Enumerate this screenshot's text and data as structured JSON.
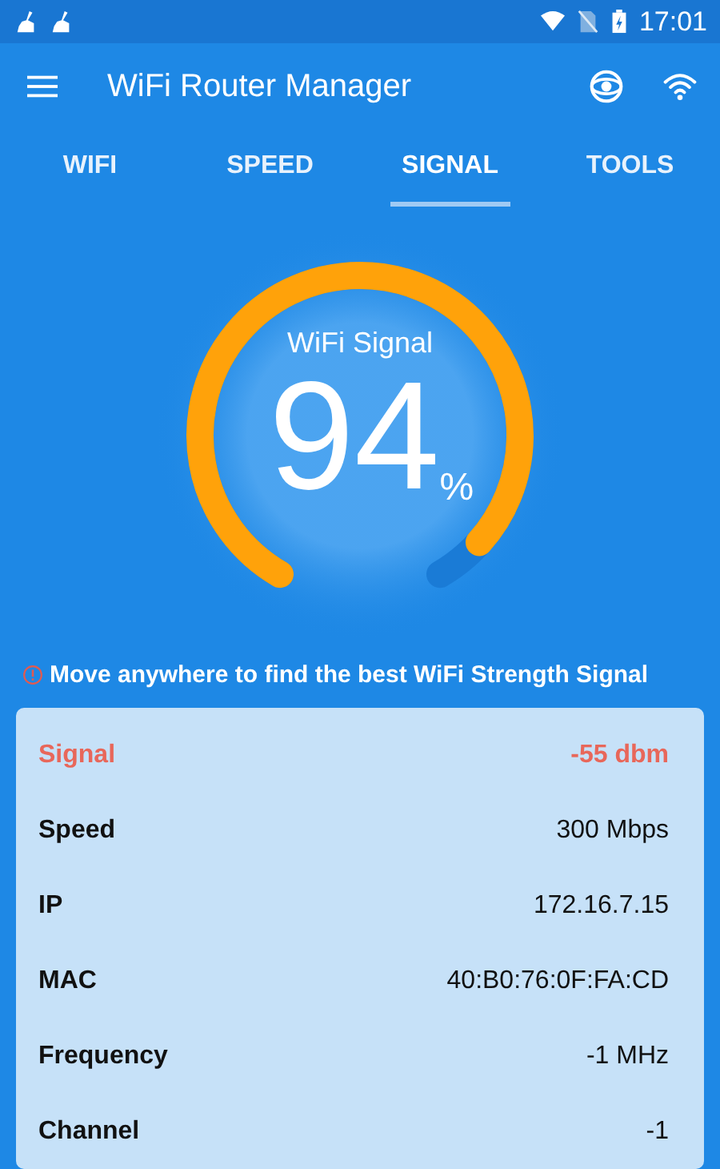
{
  "status_bar": {
    "time": "17:01"
  },
  "app_bar": {
    "title": "WiFi Router Manager"
  },
  "tabs": [
    {
      "label": "WIFI",
      "selected": false
    },
    {
      "label": "SPEED",
      "selected": false
    },
    {
      "label": "SIGNAL",
      "selected": true
    },
    {
      "label": "TOOLS",
      "selected": false
    }
  ],
  "gauge": {
    "title": "WiFi Signal",
    "value": "94",
    "unit": "%"
  },
  "hint": "Move anywhere to find the best WiFi Strength Signal",
  "details": [
    {
      "label": "Signal",
      "value": "-55 dbm",
      "highlighted": true
    },
    {
      "label": "Speed",
      "value": "300 Mbps",
      "highlighted": false
    },
    {
      "label": "IP",
      "value": "172.16.7.15",
      "highlighted": false
    },
    {
      "label": "MAC",
      "value": "40:B0:76:0F:FA:CD",
      "highlighted": false
    },
    {
      "label": "Frequency",
      "value": "-1 MHz",
      "highlighted": false
    },
    {
      "label": "Channel",
      "value": "-1",
      "highlighted": false
    }
  ]
}
